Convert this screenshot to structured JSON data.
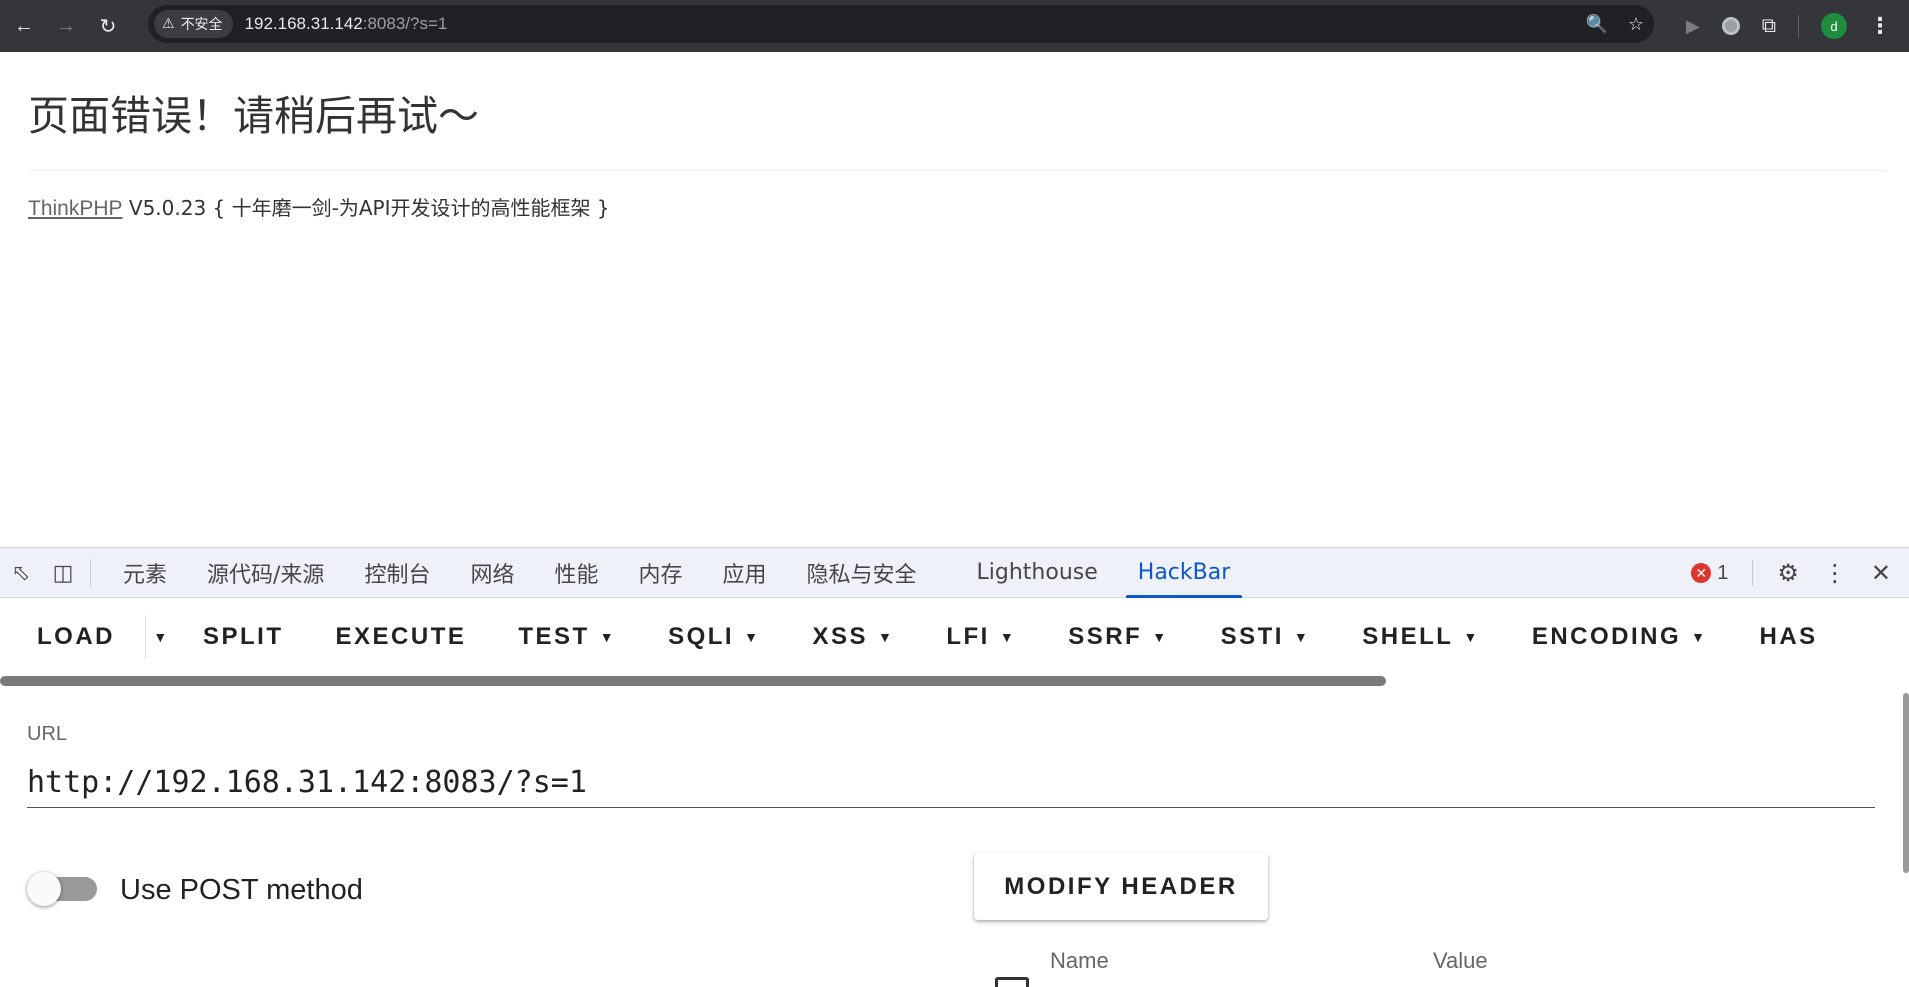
{
  "browser": {
    "back_icon": "arrow-left-icon",
    "forward_icon": "arrow-right-icon",
    "reload_icon": "reload-icon",
    "security_label": "不安全",
    "url_host": "192.168.31.142",
    "url_rest": ":8083/?s=1",
    "avatar_letter": "d"
  },
  "page": {
    "error_title": "页面错误！请稍后再试～",
    "framework_link": "ThinkPHP",
    "framework_version": " V5.0.23 { 十年磨一剑-为API开发设计的高性能框架 }"
  },
  "devtools": {
    "tabs": [
      "元素",
      "源代码/来源",
      "控制台",
      "网络",
      "性能",
      "内存",
      "应用",
      "隐私与安全",
      "Lighthouse",
      "HackBar"
    ],
    "active_tab": "HackBar",
    "error_count": "1"
  },
  "hackbar": {
    "toolbar": {
      "load": "LOAD",
      "split": "SPLIT",
      "execute": "EXECUTE",
      "test": "TEST",
      "sqli": "SQLI",
      "xss": "XSS",
      "lfi": "LFI",
      "ssrf": "SSRF",
      "ssti": "SSTI",
      "shell": "SHELL",
      "encoding": "ENCODING",
      "hashing": "HAS"
    },
    "url_label": "URL",
    "url_value": "http://192.168.31.142:8083/?s=1",
    "post_label": "Use POST method",
    "post_enabled": false,
    "modify_header": "MODIFY HEADER",
    "headers_columns": {
      "name": "Name",
      "value": "Value"
    }
  }
}
